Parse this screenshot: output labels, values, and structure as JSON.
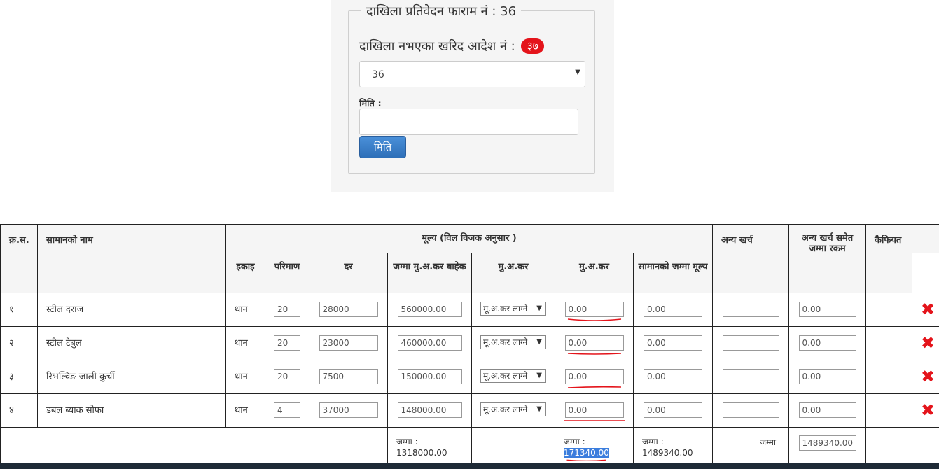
{
  "form": {
    "legend": "दाखिला प्रतिवेदन फाराम नं : 36",
    "order_label": "दाखिला नभएका खरिद आदेश नं :",
    "order_badge": "३७",
    "order_select_value": "36",
    "date_label": "मिति :",
    "date_value": "",
    "date_button": "मिति"
  },
  "table": {
    "headers": {
      "sn": "क्र.स.",
      "item_name": "सामानको नाम",
      "price_group": "मूल्य (विल विजक अनुसार )",
      "other_cost": "अन्य खर्च",
      "total_with_other": "अन्य खर्च समेत जम्मा रकम",
      "remarks": "कैफियत",
      "unit": "इकाइ",
      "quantity": "परिमाण",
      "rate": "दर",
      "total_excl_vat": "जम्मा मु.अ.कर बाहेक",
      "vat_type": "मु.अ.कर",
      "vat": "मु.अ.कर",
      "item_total": "सामानको जम्मा मूल्य"
    },
    "rows": [
      {
        "sn": "१",
        "name": "स्टील दराज",
        "unit": "थान",
        "qty": "20",
        "rate": "28000",
        "total_excl": "560000.00",
        "vat_type": "मू.अ.कर लाग्ने",
        "vat": "0.00",
        "item_total": "0.00",
        "other": "",
        "grand": "0.00"
      },
      {
        "sn": "२",
        "name": "स्टील टेबुल",
        "unit": "थान",
        "qty": "20",
        "rate": "23000",
        "total_excl": "460000.00",
        "vat_type": "मू.अ.कर लाग्ने",
        "vat": "0.00",
        "item_total": "0.00",
        "other": "",
        "grand": "0.00"
      },
      {
        "sn": "३",
        "name": "रिभल्विङ जाली कुर्ची",
        "unit": "थान",
        "qty": "20",
        "rate": "7500",
        "total_excl": "150000.00",
        "vat_type": "मू.अ.कर लाग्ने",
        "vat": "0.00",
        "item_total": "0.00",
        "other": "",
        "grand": "0.00"
      },
      {
        "sn": "४",
        "name": "डबल ब्याक सोफा",
        "unit": "थान",
        "qty": "4",
        "rate": "37000",
        "total_excl": "148000.00",
        "vat_type": "मू.अ.कर लाग्ने",
        "vat": "0.00",
        "item_total": "0.00",
        "other": "",
        "grand": "0.00"
      }
    ],
    "totals": {
      "excl_vat": "जम्मा : 1318000.00",
      "vat_label": "जम्मा :",
      "vat_value": "171340.00",
      "item_total_label": "जम्मा :",
      "item_total_value": "1489340.00",
      "other_label": "जम्मा",
      "grand_value": "1489340.00"
    }
  },
  "icons": {
    "delete": "close-x-icon"
  },
  "colors": {
    "badge": "#e4141b",
    "delete": "#e4141b",
    "button": "#2e6fb8",
    "annotation": "#e4141b",
    "highlight": "#3b7ddd"
  }
}
